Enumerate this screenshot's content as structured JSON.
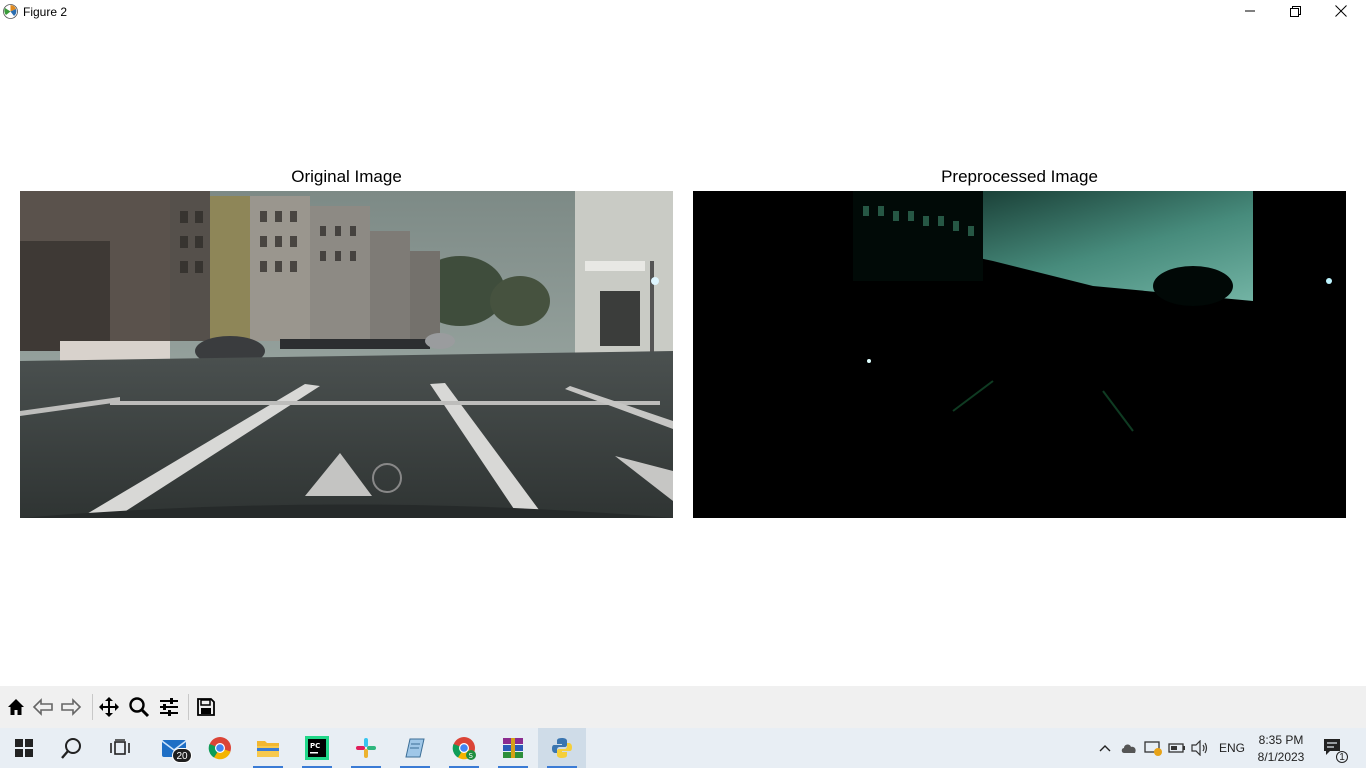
{
  "window": {
    "title": "Figure 2"
  },
  "figure": {
    "panels": [
      {
        "title": "Original Image"
      },
      {
        "title": "Preprocessed Image"
      }
    ]
  },
  "toolbar": {
    "buttons": [
      "home-icon",
      "back-icon",
      "forward-icon",
      "pan-icon",
      "zoom-icon",
      "configure-subplots-icon",
      "save-icon"
    ]
  },
  "taskbar": {
    "apps": [
      "start",
      "search",
      "task-view",
      "mail",
      "chrome",
      "file-explorer",
      "pycharm",
      "slack",
      "notepad",
      "chrome-profile",
      "winrar",
      "python"
    ],
    "mail_badge": "20",
    "language": "ENG",
    "time": "8:35 PM",
    "date": "8/1/2023",
    "notifications": "1"
  },
  "colors": {
    "taskbar": "#e8eef4",
    "toolbar": "#f0f0f0",
    "accent": "#3a7bd5"
  }
}
